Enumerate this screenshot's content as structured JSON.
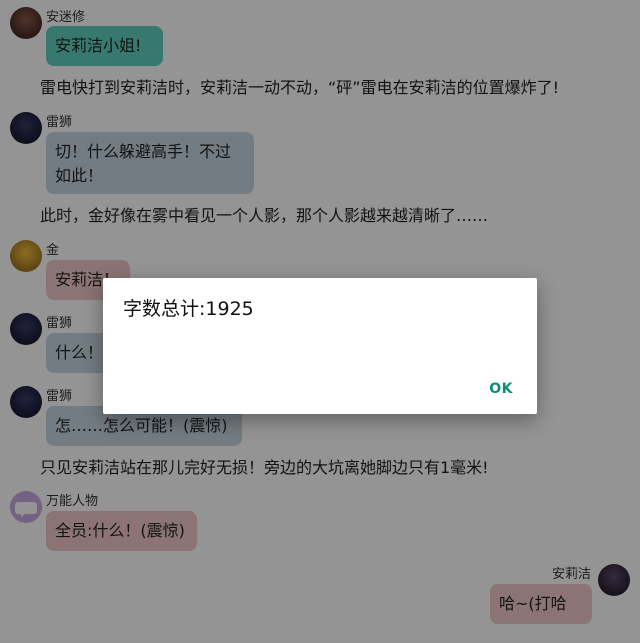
{
  "messages": [
    {
      "name": "安迷修",
      "text": "安莉洁小姐!",
      "bubble_color": "#5fd0be"
    },
    {
      "narration": "雷电快打到安莉洁时，安莉洁一动不动，“砰”雷电在安莉洁的位置爆炸了!"
    },
    {
      "name": "雷狮",
      "text": "切！什么躲避高手！不过如此！",
      "bubble_color": "#c6d6e0"
    },
    {
      "narration": "此时，金好像在雾中看见一个人影，那个人影越来越清晰了……"
    },
    {
      "name": "金",
      "text": "安莉洁！",
      "bubble_color": "#f2c9c9"
    },
    {
      "name": "雷狮",
      "text": "什么！",
      "bubble_color": "#c6d6e0"
    },
    {
      "name": "雷狮",
      "text": "怎……怎么可能！(震惊)",
      "bubble_color": "#c6d6e0"
    },
    {
      "narration": "只见安莉洁站在那儿完好无损！旁边的大坑离她脚边只有1毫米!"
    },
    {
      "name": "万能人物",
      "text": "全员:什么！(震惊)",
      "bubble_color": "#f2c9c9"
    },
    {
      "name": "安莉洁",
      "text": "哈~(打哈",
      "bubble_color": "#f2c9c9"
    }
  ],
  "dialog": {
    "message": "字数总计:1925",
    "ok_label": "OK",
    "accent": "#0a8f7a"
  }
}
